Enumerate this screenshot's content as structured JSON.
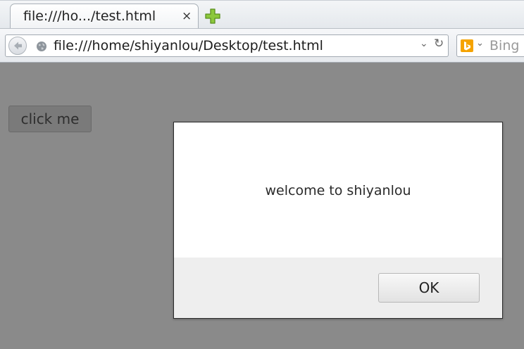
{
  "tab": {
    "title": "file:///ho.../test.html",
    "close_glyph": "×",
    "new_tab_icon": "plus-icon"
  },
  "navbar": {
    "back_icon": "back-arrow-icon",
    "site_icon": "globe-icon",
    "url": "file:///home/shiyanlou/Desktop/test.html",
    "dropmarker_glyph": "⌄",
    "reload_glyph": "↻"
  },
  "search": {
    "engine_icon": "bing-icon",
    "dropmarker_glyph": "⌄",
    "placeholder": "Bing"
  },
  "page": {
    "button_label": "click me",
    "background_color": "#8a8a8a"
  },
  "dialog": {
    "message": "welcome to shiyanlou",
    "ok_label": "OK"
  }
}
